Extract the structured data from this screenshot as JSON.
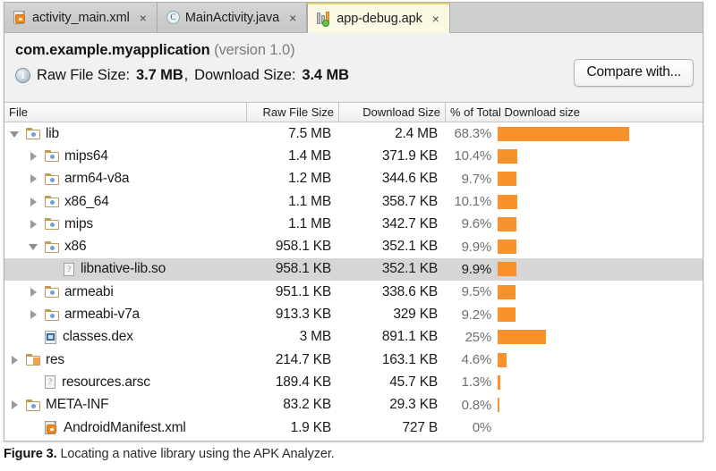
{
  "window": {
    "tabs": [
      {
        "label": "activity_main.xml",
        "icon": "xml-file-icon",
        "active": false,
        "close": "×"
      },
      {
        "label": "MainActivity.java",
        "icon": "java-class-icon",
        "active": false,
        "close": "×"
      },
      {
        "label": "app-debug.apk",
        "icon": "apk-file-icon",
        "active": true,
        "close": "×"
      }
    ]
  },
  "apk_header": {
    "info_icon": "info-icon",
    "info_glyph": "i",
    "package_name": "com.example.myapplication",
    "version": "(version 1.0)",
    "raw_label": "Raw File Size:",
    "raw_value": "3.7 MB",
    "separator": ",",
    "download_label": "Download Size:",
    "download_value": "3.4 MB",
    "compare_button": "Compare with..."
  },
  "table": {
    "columns": [
      "File",
      "Raw File Size",
      "Download Size",
      "% of Total Download size"
    ],
    "accent_color": "#f7922d",
    "selection_color": "#d6d6d6",
    "rows": [
      {
        "name": "lib",
        "icon": "folder-icon",
        "depth": 0,
        "twisty": "open",
        "raw": "7.5 MB",
        "download": "2.4 MB",
        "pct_label": "68.3%",
        "pct": 68.3,
        "selected": false
      },
      {
        "name": "mips64",
        "icon": "folder-icon",
        "depth": 1,
        "twisty": "closed",
        "raw": "1.4 MB",
        "download": "371.9 KB",
        "pct_label": "10.4%",
        "pct": 10.4,
        "selected": false
      },
      {
        "name": "arm64-v8a",
        "icon": "folder-icon",
        "depth": 1,
        "twisty": "closed",
        "raw": "1.2 MB",
        "download": "344.6 KB",
        "pct_label": "9.7%",
        "pct": 9.7,
        "selected": false
      },
      {
        "name": "x86_64",
        "icon": "folder-icon",
        "depth": 1,
        "twisty": "closed",
        "raw": "1.1 MB",
        "download": "358.7 KB",
        "pct_label": "10.1%",
        "pct": 10.1,
        "selected": false
      },
      {
        "name": "mips",
        "icon": "folder-icon",
        "depth": 1,
        "twisty": "closed",
        "raw": "1.1 MB",
        "download": "342.7 KB",
        "pct_label": "9.6%",
        "pct": 9.6,
        "selected": false
      },
      {
        "name": "x86",
        "icon": "folder-icon",
        "depth": 1,
        "twisty": "open",
        "raw": "958.1 KB",
        "download": "352.1 KB",
        "pct_label": "9.9%",
        "pct": 9.9,
        "selected": false
      },
      {
        "name": "libnative-lib.so",
        "icon": "unknown-file-icon",
        "depth": 2,
        "twisty": "none",
        "raw": "958.1 KB",
        "download": "352.1 KB",
        "pct_label": "9.9%",
        "pct": 9.9,
        "selected": true
      },
      {
        "name": "armeabi",
        "icon": "folder-icon",
        "depth": 1,
        "twisty": "closed",
        "raw": "951.1 KB",
        "download": "338.6 KB",
        "pct_label": "9.5%",
        "pct": 9.5,
        "selected": false
      },
      {
        "name": "armeabi-v7a",
        "icon": "folder-icon",
        "depth": 1,
        "twisty": "closed",
        "raw": "913.3 KB",
        "download": "329 KB",
        "pct_label": "9.2%",
        "pct": 9.2,
        "selected": false
      },
      {
        "name": "classes.dex",
        "icon": "dex-file-icon",
        "depth": 1,
        "twisty": "none",
        "raw": "3 MB",
        "download": "891.1 KB",
        "pct_label": "25%",
        "pct": 25.0,
        "selected": false
      },
      {
        "name": "res",
        "icon": "res-folder-icon",
        "depth": 0,
        "twisty": "closed",
        "raw": "214.7 KB",
        "download": "163.1 KB",
        "pct_label": "4.6%",
        "pct": 4.6,
        "selected": false
      },
      {
        "name": "resources.arsc",
        "icon": "unknown-file-icon",
        "depth": 1,
        "twisty": "none",
        "raw": "189.4 KB",
        "download": "45.7 KB",
        "pct_label": "1.3%",
        "pct": 1.3,
        "selected": false
      },
      {
        "name": "META-INF",
        "icon": "folder-icon",
        "depth": 0,
        "twisty": "closed",
        "raw": "83.2 KB",
        "download": "29.3 KB",
        "pct_label": "0.8%",
        "pct": 0.8,
        "selected": false
      },
      {
        "name": "AndroidManifest.xml",
        "icon": "xml-file-icon",
        "depth": 1,
        "twisty": "none",
        "raw": "1.9 KB",
        "download": "727 B",
        "pct_label": "0%",
        "pct": 0.0,
        "selected": false
      }
    ]
  },
  "caption": {
    "figure": "Figure 3.",
    "text": " Locating a native library using the APK Analyzer."
  },
  "chart_data": {
    "type": "bar",
    "title": "% of Total Download size",
    "categories": [
      "lib",
      "mips64",
      "arm64-v8a",
      "x86_64",
      "mips",
      "x86",
      "libnative-lib.so",
      "armeabi",
      "armeabi-v7a",
      "classes.dex",
      "res",
      "resources.arsc",
      "META-INF",
      "AndroidManifest.xml"
    ],
    "values": [
      68.3,
      10.4,
      9.7,
      10.1,
      9.6,
      9.9,
      9.9,
      9.5,
      9.2,
      25.0,
      4.6,
      1.3,
      0.8,
      0.0
    ],
    "xlabel": "",
    "ylabel": "",
    "xlim": [
      0,
      100
    ],
    "grid": false,
    "legend": false,
    "orientation": "horizontal"
  }
}
